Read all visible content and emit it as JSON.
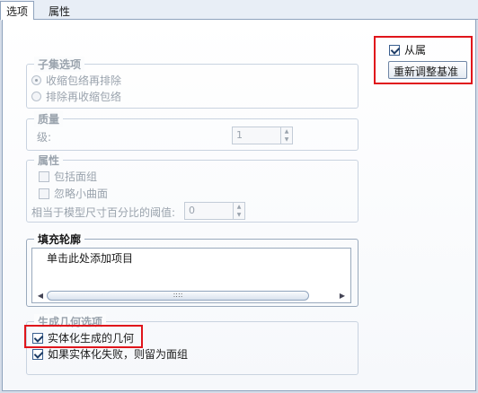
{
  "tabs": {
    "options": "选项",
    "properties": "属性"
  },
  "dependent": {
    "checkbox_label": "从属",
    "checked": true,
    "rescale_button": "重新调整基准"
  },
  "subset": {
    "title": "子集选项",
    "radio1": "收缩包络再排除",
    "radio2": "排除再收缩包络"
  },
  "quality": {
    "title": "质量",
    "level_label": "级:",
    "level_value": "1"
  },
  "attributes": {
    "title": "属性",
    "include_quilts": "包括面组",
    "ignore_small": "忽略小曲面",
    "threshold_label": "相当于模型尺寸百分比的阈值:",
    "threshold_value": "0"
  },
  "fill": {
    "title": "填充轮廓",
    "placeholder_item": "单击此处添加项目",
    "scroll_thumb": "::::"
  },
  "geometry": {
    "title": "生成几何选项",
    "solidify": "实体化生成的几何",
    "fallback": "如果实体化失败，则留为面组"
  },
  "colors": {
    "highlight_box": "#e0151b"
  }
}
